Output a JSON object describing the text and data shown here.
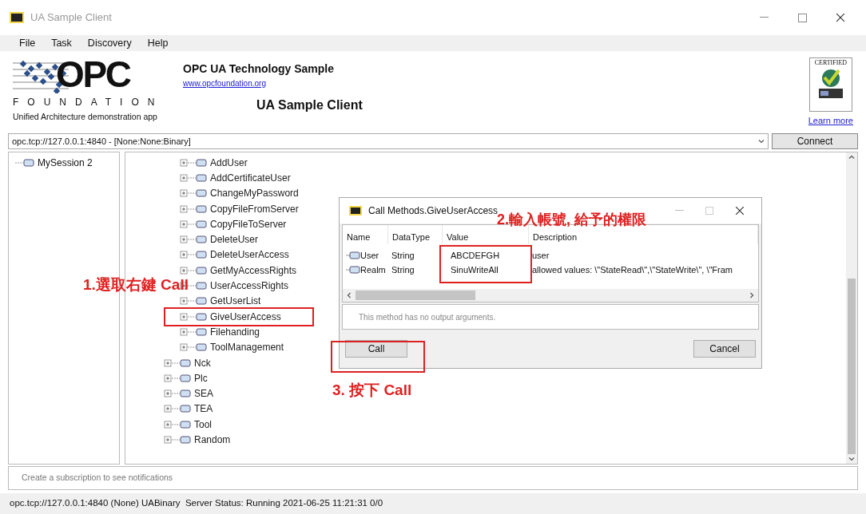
{
  "window": {
    "title": "UA Sample Client"
  },
  "menu": [
    "File",
    "Task",
    "Discovery",
    "Help"
  ],
  "header": {
    "logo_text": "OPC",
    "logo_subtitle": "FOUNDATION",
    "tagline": "Unified Architecture demonstration app",
    "title": "OPC UA Technology Sample",
    "link": "www.opcfoundation.org",
    "subtitle": "UA Sample Client",
    "badge_text": "CERTIFIED",
    "badge_link": "Learn more"
  },
  "address": {
    "value": "opc.tcp://127.0.0.1:4840 - [None:None:Binary]",
    "button": "Connect"
  },
  "sessions": [
    {
      "label": "MySession 2"
    }
  ],
  "tree": [
    {
      "children": [
        {
          "label": "AddUser",
          "boxed": false
        },
        {
          "label": "AddCertificateUser",
          "boxed": false
        },
        {
          "label": "ChangeMyPassword",
          "boxed": false
        },
        {
          "label": "CopyFileFromServer",
          "boxed": false
        },
        {
          "label": "CopyFileToServer",
          "boxed": false
        },
        {
          "label": "DeleteUser",
          "boxed": false
        },
        {
          "label": "DeleteUserAccess",
          "boxed": false
        },
        {
          "label": "GetMyAccessRights",
          "boxed": false
        },
        {
          "label": "UserAccessRights",
          "boxed": false
        },
        {
          "label": "GetUserList",
          "boxed": false
        },
        {
          "label": "GiveUserAccess",
          "boxed": true
        },
        {
          "label": "Filehanding",
          "boxed": false
        },
        {
          "label": "ToolManagement",
          "boxed": false
        }
      ]
    },
    {
      "label": "Nck"
    },
    {
      "label": "Plc"
    },
    {
      "label": "SEA"
    },
    {
      "label": "TEA"
    },
    {
      "label": "Tool"
    },
    {
      "label": "Random"
    }
  ],
  "dialog": {
    "title": "Call Methods.GiveUserAccess",
    "columns": [
      "Name",
      "DataType",
      "Value",
      "Description"
    ],
    "rows": [
      {
        "name": "User",
        "type": "String",
        "value": "ABCDEFGH",
        "description": "user"
      },
      {
        "name": "Realm",
        "type": "String",
        "value": "SinuWriteAll",
        "description": "allowed values: \\\"StateRead\\\",\\\"StateWrite\\\", \\\"Fram"
      }
    ],
    "value_boxed": true,
    "output": "This method has no output arguments.",
    "buttons": [
      {
        "label": "Call",
        "boxed": true
      },
      {
        "label": "Cancel",
        "boxed": false
      }
    ]
  },
  "annotations": [
    "1.選取右鍵 Call",
    "2.輸入帳號, 給予的權限",
    "3. 按下 Call"
  ],
  "notifications": "Create a subscription to see notifications",
  "status_bar": "opc.tcp://127.0.0.1:4840 (None) UABinary  Server Status: Running 2021-06-25 11:21:31 0/0"
}
